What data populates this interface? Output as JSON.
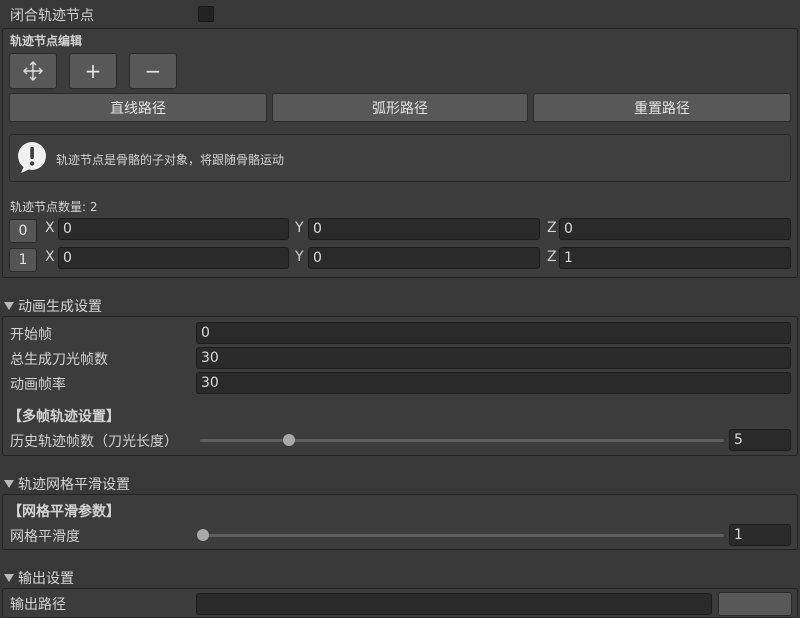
{
  "closed_trail": {
    "label": "闭合轨迹节点",
    "checked": false
  },
  "node_edit": {
    "title": "轨迹节点编辑",
    "move_icon": "move-icon",
    "add_label": "+",
    "remove_label": "−",
    "straight_label": "直线路径",
    "arc_label": "弧形路径",
    "reset_label": "重置路径"
  },
  "info": {
    "icon": "warning-icon",
    "text": "轨迹节点是骨骼的子对象，将跟随骨骼运动"
  },
  "nodes": {
    "count_label": "轨迹节点数量: 2",
    "rows": [
      {
        "index": "0",
        "x_label": "X",
        "x": "0",
        "y_label": "Y",
        "y": "0",
        "z_label": "Z",
        "z": "0"
      },
      {
        "index": "1",
        "x_label": "X",
        "x": "0",
        "y_label": "Y",
        "y": "0",
        "z_label": "Z",
        "z": "1"
      }
    ]
  },
  "anim": {
    "title": "动画生成设置",
    "start_frame_label": "开始帧",
    "start_frame": "0",
    "total_frames_label": "总生成刀光帧数",
    "total_frames": "30",
    "fps_label": "动画帧率",
    "fps": "30",
    "multi_title": "【多帧轨迹设置】",
    "history_label": "历史轨迹帧数（刀光长度）",
    "history_value": "5"
  },
  "mesh": {
    "title": "轨迹网格平滑设置",
    "params_title": "【网格平滑参数】",
    "smooth_label": "网格平滑度",
    "smooth_value": "1"
  },
  "output": {
    "title": "输出设置",
    "path_label": "输出路径"
  }
}
